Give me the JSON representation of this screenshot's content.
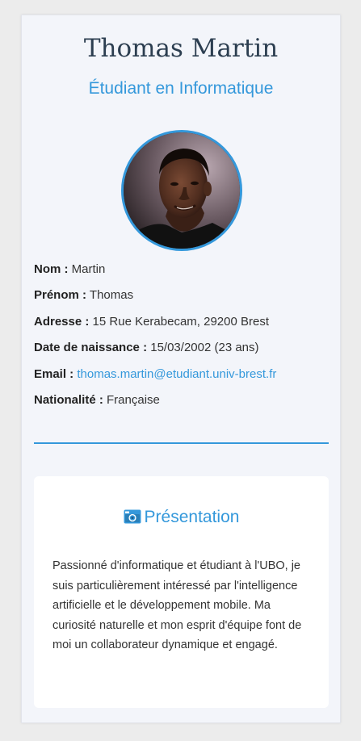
{
  "profile": {
    "name": "Thomas Martin",
    "subtitle": "Étudiant en Informatique"
  },
  "info": {
    "nom_label": "Nom :",
    "nom_value": "Martin",
    "prenom_label": "Prénom :",
    "prenom_value": "Thomas",
    "adresse_label": "Adresse :",
    "adresse_value": "15 Rue Kerabecam, 29200 Brest",
    "naissance_label": "Date de naissance :",
    "naissance_value": "15/03/2002 (23 ans)",
    "email_label": "Email :",
    "email_value": "thomas.martin@etudiant.univ-brest.fr",
    "nationalite_label": "Nationalité :",
    "nationalite_value": "Française"
  },
  "presentation": {
    "icon": "camera-icon",
    "title": "Présentation",
    "text": "Passionné d'informatique et étudiant à l'UBO, je suis particulièrement intéressé par l'intelligence artificielle et le développement mobile. Ma curiosité naturelle et mon esprit d'équipe font de moi un collaborateur dynamique et engagé."
  },
  "colors": {
    "accent": "#3498db",
    "heading": "#2c3e50",
    "card_bg": "#f3f5fa",
    "page_bg": "#ececec"
  }
}
